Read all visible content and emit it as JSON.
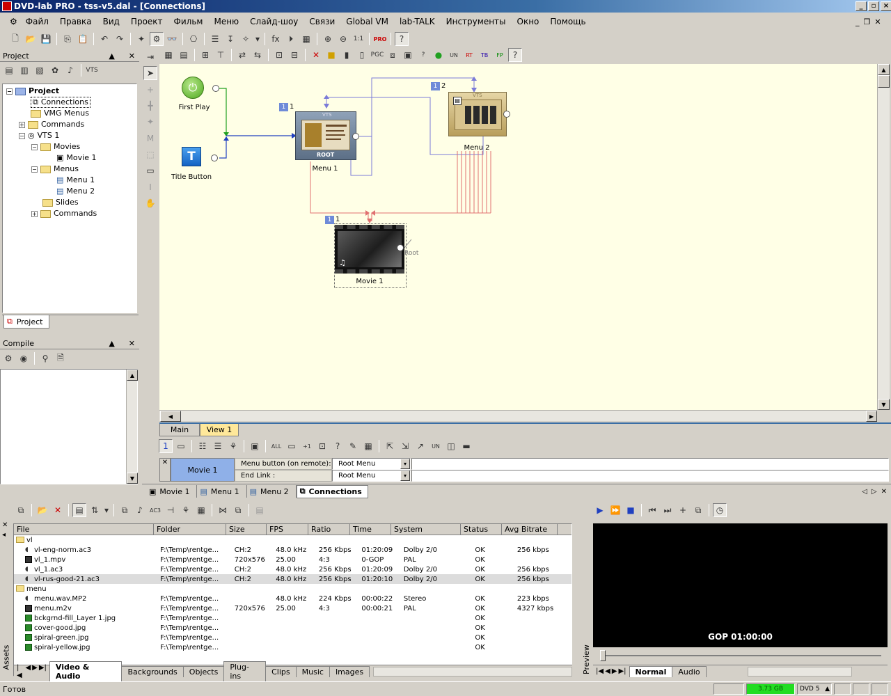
{
  "window": {
    "title": "DVD-lab PRO - tss-v5.dal - [Connections]"
  },
  "menu": [
    "Файл",
    "Правка",
    "Вид",
    "Проект",
    "Фильм",
    "Меню",
    "Слайд-шоу",
    "Связи",
    "Global VM",
    "lab-TALK",
    "Инструменты",
    "Окно",
    "Помощь"
  ],
  "project_panel": {
    "title": "Project",
    "tree": {
      "root": "Project",
      "connections": "Connections",
      "vmg_menus": "VMG Menus",
      "commands": "Commands",
      "vts": "VTS 1",
      "movies": "Movies",
      "movie1": "Movie 1",
      "menus": "Menus",
      "menu1": "Menu 1",
      "menu2": "Menu 2",
      "slides": "Slides",
      "commands2": "Commands"
    },
    "tab": "Project"
  },
  "compile_panel": {
    "title": "Compile"
  },
  "canvas": {
    "first_play": "First Play",
    "title_button": "Title Button",
    "menu1": {
      "label": "Menu 1",
      "badge": "1",
      "num": "1",
      "root": "ROOT",
      "vts": "VTS"
    },
    "menu2": {
      "label": "Menu 2",
      "badge": "1",
      "num": "2",
      "vts": "VTS"
    },
    "movie1": {
      "label": "Movie 1",
      "badge": "1",
      "num": "1",
      "root_tag": "Root"
    }
  },
  "view_tabs": [
    "Main",
    "View 1"
  ],
  "props": {
    "selected": "Movie 1",
    "rows": [
      {
        "label": "Menu button (on remote):",
        "value": "Root Menu"
      },
      {
        "label": "End Link :",
        "value": "Root Menu"
      }
    ]
  },
  "doc_tabs": [
    "Movie 1",
    "Menu 1",
    "Menu 2",
    "Connections"
  ],
  "assets": {
    "side_label": "Assets",
    "columns": [
      "File",
      "Folder",
      "Size",
      "FPS",
      "Ratio",
      "Time",
      "System",
      "Status",
      "Avg Bitrate"
    ],
    "rows": [
      {
        "type": "folder",
        "file": "vl"
      },
      {
        "type": "audio",
        "file": "vl-eng-norm.ac3",
        "folder": "F:\\Temp\\rentge...",
        "size": "CH:2",
        "fps": "48.0 kHz",
        "ratio": "256 Kbps",
        "time": "01:20:09",
        "system": "Dolby 2/0",
        "status": "OK",
        "bitrate": "256 kbps"
      },
      {
        "type": "video",
        "file": "vl_1.mpv",
        "folder": "F:\\Temp\\rentge...",
        "size": "720x576",
        "fps": "25.00",
        "ratio": "4:3",
        "time": "0-GOP",
        "system": "PAL",
        "status": "OK",
        "bitrate": ""
      },
      {
        "type": "audio",
        "file": "vl_1.ac3",
        "folder": "F:\\Temp\\rentge...",
        "size": "CH:2",
        "fps": "48.0 kHz",
        "ratio": "256 Kbps",
        "time": "01:20:09",
        "system": "Dolby 2/0",
        "status": "OK",
        "bitrate": "256 kbps"
      },
      {
        "type": "audio",
        "file": "vl-rus-good-21.ac3",
        "folder": "F:\\Temp\\rentge...",
        "size": "CH:2",
        "fps": "48.0 kHz",
        "ratio": "256 Kbps",
        "time": "01:20:10",
        "system": "Dolby 2/0",
        "status": "OK",
        "bitrate": "256 kbps",
        "selected": true
      },
      {
        "type": "folder",
        "file": "menu"
      },
      {
        "type": "audio",
        "file": "menu.wav.MP2",
        "folder": "F:\\Temp\\rentge...",
        "size": "",
        "fps": "48.0 kHz",
        "ratio": "224 Kbps",
        "time": "00:00:22",
        "system": "Stereo",
        "status": "OK",
        "bitrate": "223 kbps"
      },
      {
        "type": "video",
        "file": "menu.m2v",
        "folder": "F:\\Temp\\rentge...",
        "size": "720x576",
        "fps": "25.00",
        "ratio": "4:3",
        "time": "00:00:21",
        "system": "PAL",
        "status": "OK",
        "bitrate": "4327 kbps"
      },
      {
        "type": "image",
        "file": "bckgrnd-fill_Layer 1.jpg",
        "folder": "F:\\Temp\\rentge...",
        "size": "",
        "fps": "",
        "ratio": "",
        "time": "",
        "system": "",
        "status": "OK",
        "bitrate": ""
      },
      {
        "type": "image",
        "file": "cover-good.jpg",
        "folder": "F:\\Temp\\rentge...",
        "size": "",
        "fps": "",
        "ratio": "",
        "time": "",
        "system": "",
        "status": "OK",
        "bitrate": ""
      },
      {
        "type": "image",
        "file": "spiral-green.jpg",
        "folder": "F:\\Temp\\rentge...",
        "size": "",
        "fps": "",
        "ratio": "",
        "time": "",
        "system": "",
        "status": "OK",
        "bitrate": ""
      },
      {
        "type": "image",
        "file": "spiral-yellow.jpg",
        "folder": "F:\\Temp\\rentge...",
        "size": "",
        "fps": "",
        "ratio": "",
        "time": "",
        "system": "",
        "status": "OK",
        "bitrate": ""
      }
    ],
    "tabs": [
      "Video & Audio",
      "Backgrounds",
      "Objects",
      "Plug-ins",
      "Clips",
      "Music",
      "Images"
    ]
  },
  "preview": {
    "side_label": "Preview",
    "timecode": "GOP 01:00:00",
    "tabs": [
      "Normal",
      "Audio"
    ]
  },
  "status": {
    "text": "Готов",
    "disk": "3.73 GB",
    "disc_type": "DVD 5"
  },
  "colors": {
    "link_blue": "#7b7bd8",
    "link_red": "#e07070",
    "link_green": "#20a020",
    "canvas_bg": "#ffffe6",
    "badge": "#6f8bd8"
  }
}
